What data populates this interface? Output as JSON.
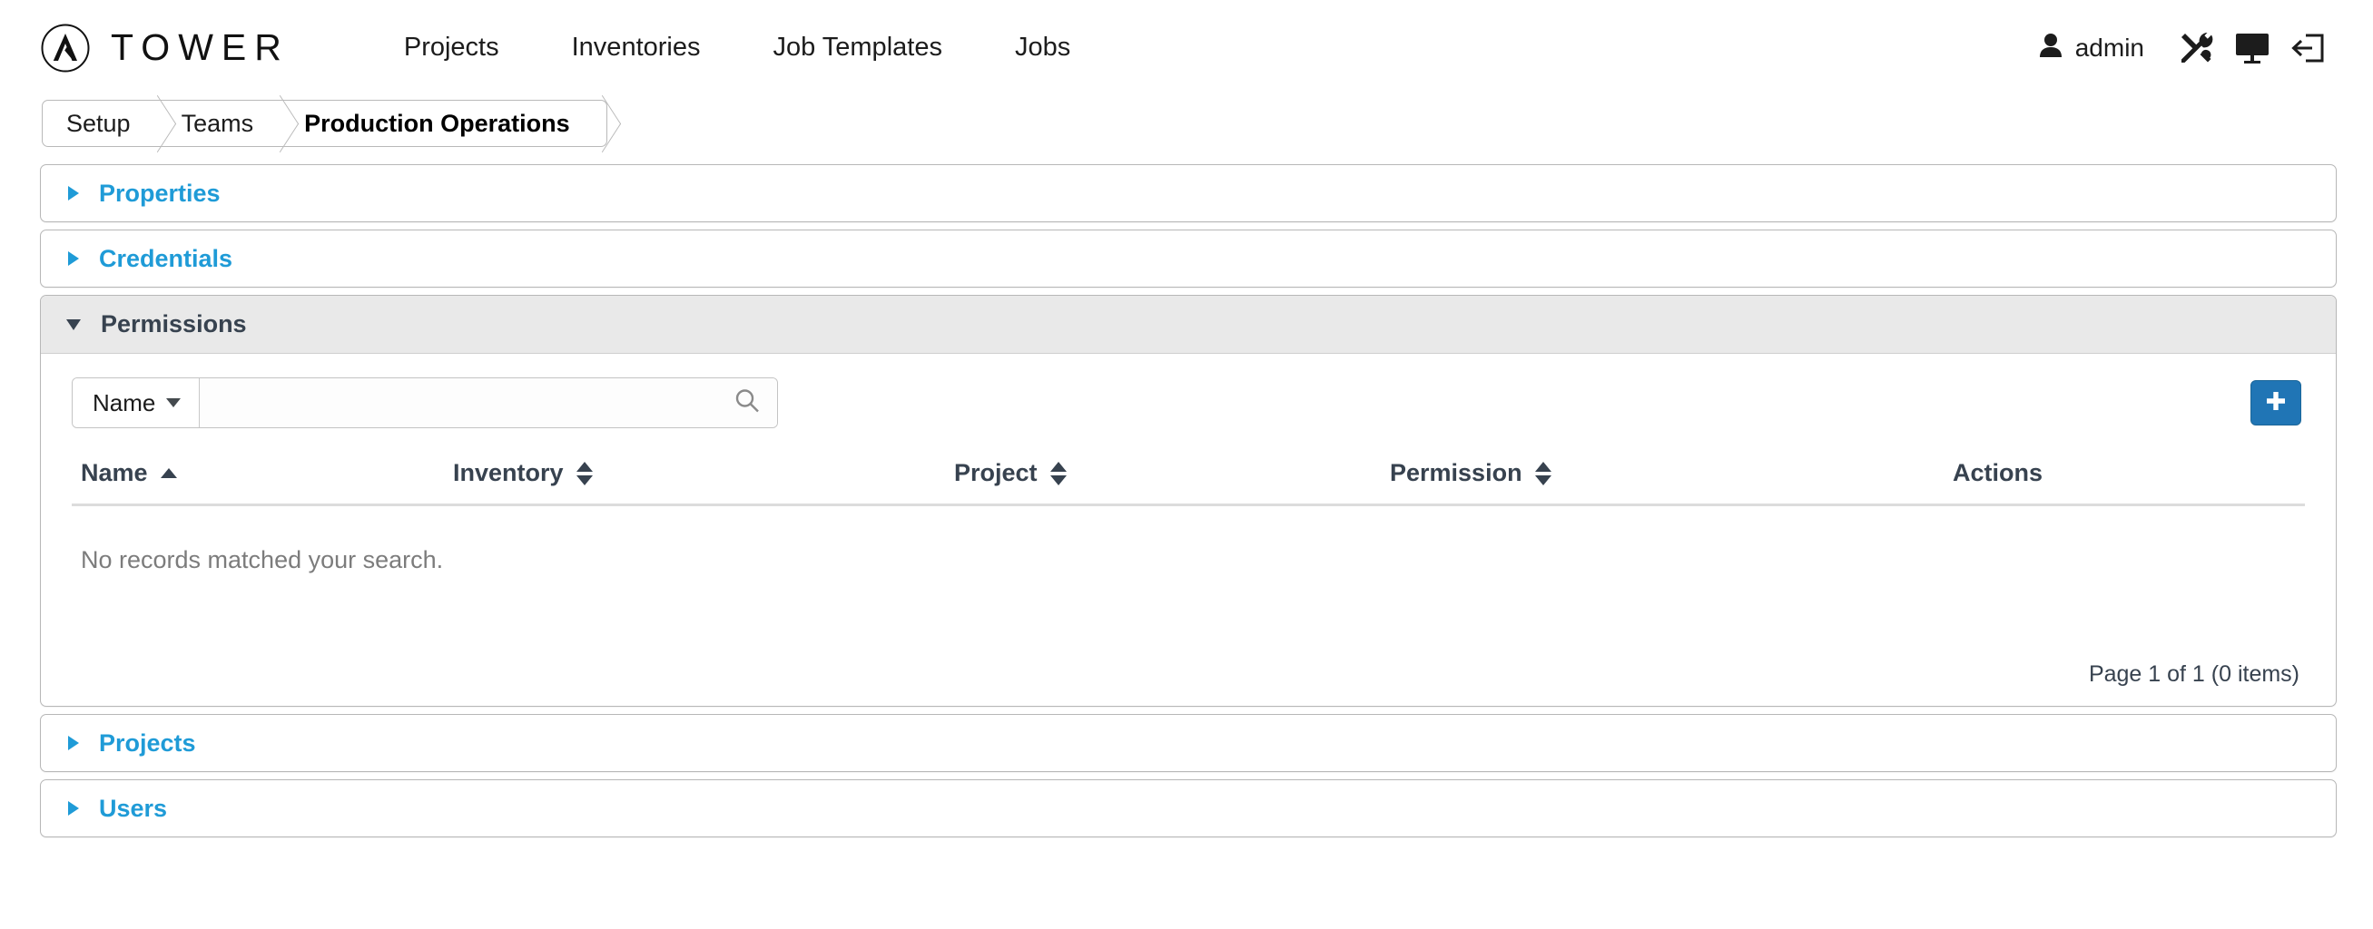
{
  "app": {
    "brand_name": "TOWER",
    "logo_icon": "ansible-logo-icon"
  },
  "navbar": {
    "links": [
      {
        "label": "Projects"
      },
      {
        "label": "Inventories"
      },
      {
        "label": "Job Templates"
      },
      {
        "label": "Jobs"
      }
    ],
    "user": {
      "name": "admin",
      "icon": "user-icon"
    },
    "icons": [
      {
        "name": "tools-icon"
      },
      {
        "name": "monitor-icon"
      },
      {
        "name": "logout-icon"
      }
    ]
  },
  "breadcrumb": {
    "items": [
      {
        "label": "Setup",
        "active": false
      },
      {
        "label": "Teams",
        "active": false
      },
      {
        "label": "Production Operations",
        "active": true
      }
    ]
  },
  "panels": [
    {
      "title": "Properties",
      "open": false
    },
    {
      "title": "Credentials",
      "open": false
    },
    {
      "title": "Permissions",
      "open": true
    },
    {
      "title": "Projects",
      "open": false
    },
    {
      "title": "Users",
      "open": false
    }
  ],
  "permissions": {
    "search": {
      "field_label": "Name",
      "value": "",
      "placeholder": "",
      "search_icon": "search-icon"
    },
    "add_button": {
      "icon": "plus-icon",
      "label": "",
      "color": "#2075b5"
    },
    "table": {
      "columns": [
        {
          "label": "Name",
          "sort": "asc"
        },
        {
          "label": "Inventory",
          "sort": "both"
        },
        {
          "label": "Project",
          "sort": "both"
        },
        {
          "label": "Permission",
          "sort": "both"
        },
        {
          "label": "Actions",
          "sort": "none"
        }
      ],
      "rows": [],
      "empty_message": "No records matched your search.",
      "pagination": "Page 1 of 1 (0 items)"
    }
  },
  "colors": {
    "link_blue": "#1f9bd7",
    "accent_blue": "#2075b5",
    "header_gray": "#e9e9e9",
    "text_dark": "#37424f"
  }
}
